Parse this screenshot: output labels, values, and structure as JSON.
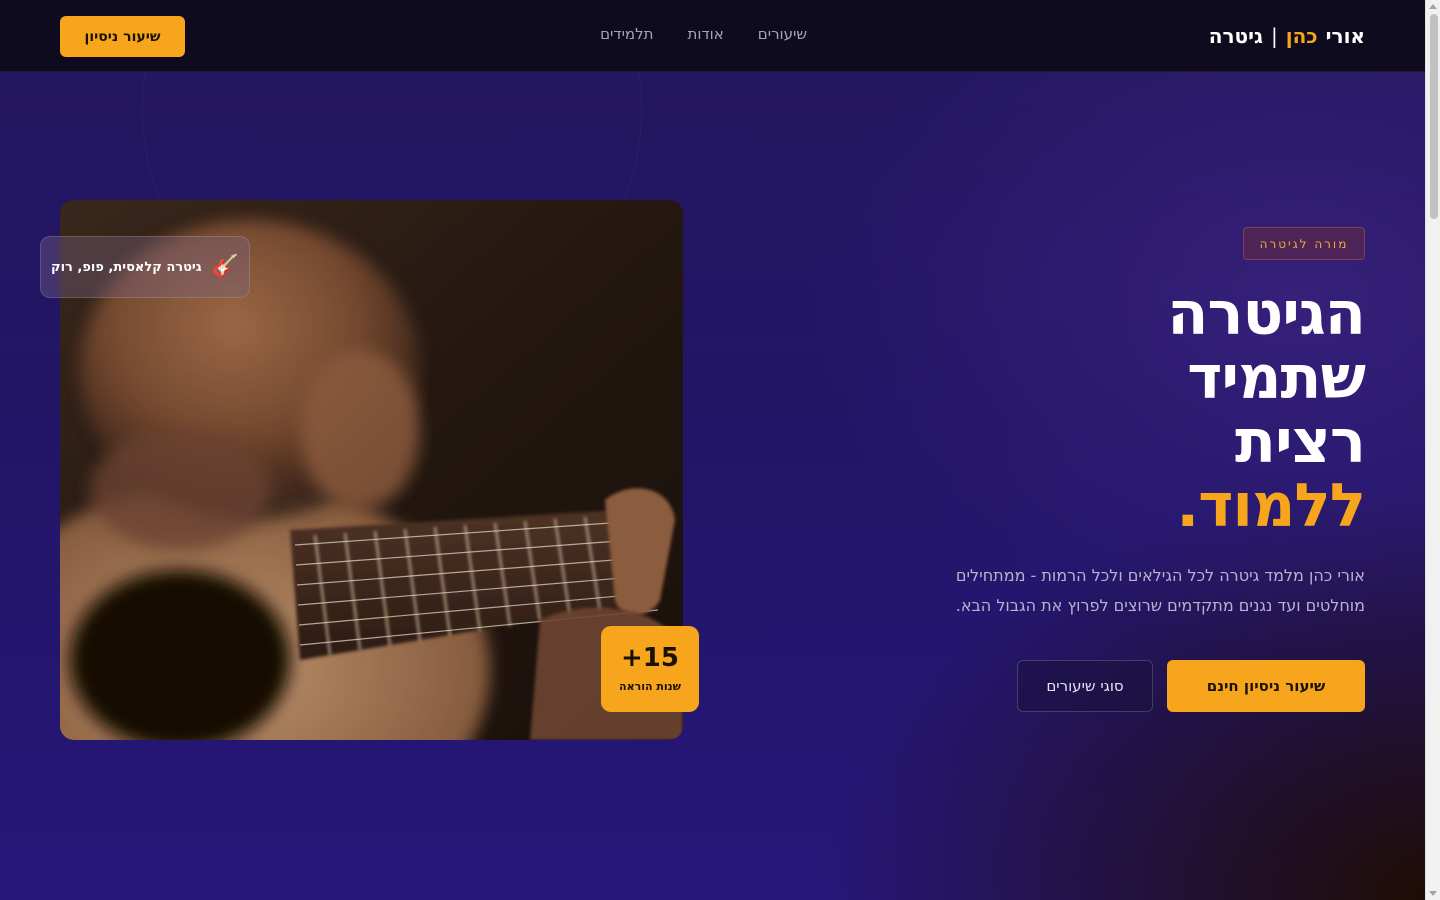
{
  "header": {
    "logo": {
      "first": "אורי",
      "accent": "כהן",
      "separator": "|",
      "last": "גיטרה"
    },
    "nav": [
      "שיעורים",
      "אודות",
      "תלמידים"
    ],
    "cta": "שיעור ניסיון"
  },
  "hero": {
    "badge": "מורה לגיטרה",
    "headline": {
      "line1": "הגיטרה",
      "line2": "שתמיד",
      "line3": "רצית",
      "accent": "ללמוד."
    },
    "subtitle": "אורי כהן מלמד גיטרה לכל הגילאים ולכל הרמות - ממתחילים מוחלטים ועד נגנים מתקדמים שרוצים לפרוץ את הגבול הבא.",
    "primary_button": "שיעור ניסיון חינם",
    "secondary_button": "סוגי שיעורים"
  },
  "image_card": {
    "tag_text": "גיטרה קלאסית, פופ, רוק",
    "tag_icon": "guitar-icon",
    "stat_number": "+15",
    "stat_label": "שנות הוראה"
  },
  "colors": {
    "accent": "#f7a51c",
    "header_bg": "#0d0b1d",
    "hero_bg": "#221566"
  }
}
